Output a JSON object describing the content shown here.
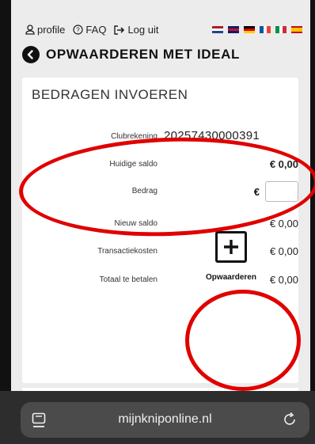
{
  "nav": {
    "profile_label": "profile",
    "faq_label": "FAQ",
    "logout_label": "Log uit"
  },
  "languages": [
    "nl",
    "en",
    "de",
    "fr",
    "it",
    "es"
  ],
  "page_title": "OPWAARDEREN MET IDEAL",
  "card": {
    "title": "BEDRAGEN INVOEREN",
    "clubrekening_label": "Clubrekening",
    "clubrekening_value": "20257430000391",
    "huidige_saldo_label": "Huidige saldo",
    "huidige_saldo_value": "€ 0,00",
    "bedrag_label": "Bedrag",
    "bedrag_currency": "€",
    "bedrag_value": "",
    "nieuw_saldo_label": "Nieuw saldo",
    "nieuw_saldo_value": "€ 0,00",
    "transactiekosten_label": "Transactiekosten",
    "transactiekosten_value": "€ 0,00",
    "totaal_label": "Totaal te betalen",
    "totaal_value": "€ 0,00"
  },
  "topup_button": {
    "label": "Opwaarderen"
  },
  "browser": {
    "url": "mijnkniponline.nl"
  },
  "colors": {
    "annotation": "#e00000",
    "url_bar": "#4b4b4b"
  },
  "icons": [
    "profile-icon",
    "faq-icon",
    "logout-icon",
    "back-arrow-icon",
    "plus-icon",
    "tabs-icon",
    "reload-icon"
  ]
}
